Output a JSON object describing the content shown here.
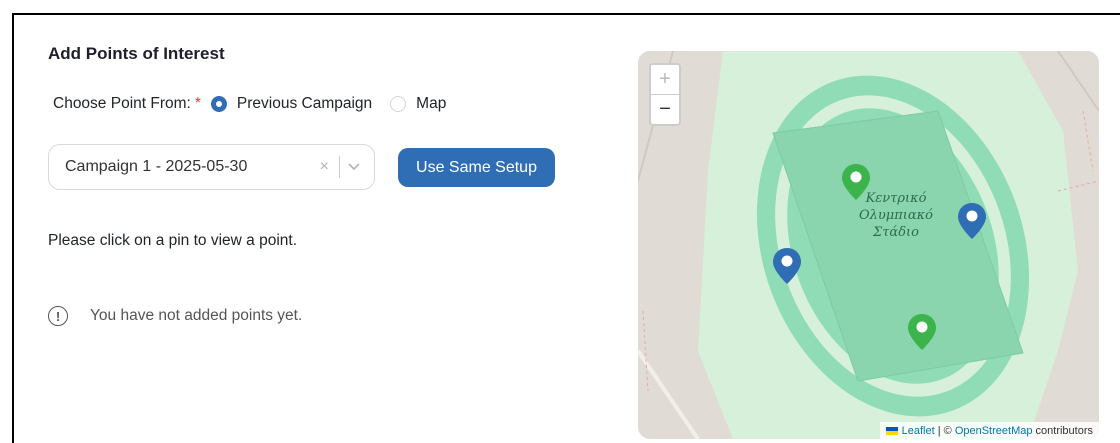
{
  "section": {
    "title": "Add Points of Interest"
  },
  "choose": {
    "label": "Choose Point From:",
    "required_mark": "*",
    "options": [
      {
        "label": "Previous Campaign",
        "selected": true
      },
      {
        "label": "Map",
        "selected": false
      }
    ]
  },
  "campaign_select": {
    "value": "Campaign 1 - 2025-05-30",
    "clear_icon": "×",
    "chevron_icon": "⌄"
  },
  "use_setup_button": {
    "label": "Use Same Setup"
  },
  "hint_text": "Please click on a pin to view a point.",
  "empty_state": {
    "icon": "!",
    "text": "You have not added points yet."
  },
  "map": {
    "zoom_in": "+",
    "zoom_out": "−",
    "stadium_label": [
      "Κεντρικό",
      "Ολυμπιακό",
      "Στάδιο"
    ],
    "attribution": {
      "leaflet": "Leaflet",
      "sep": " | © ",
      "osm": "OpenStreetMap",
      "suffix": " contributors"
    },
    "pin_colors": {
      "green": "#3cb44b",
      "blue": "#2f6db5"
    }
  },
  "colors": {
    "accent": "#2f6db5",
    "required": "#e5383b"
  }
}
